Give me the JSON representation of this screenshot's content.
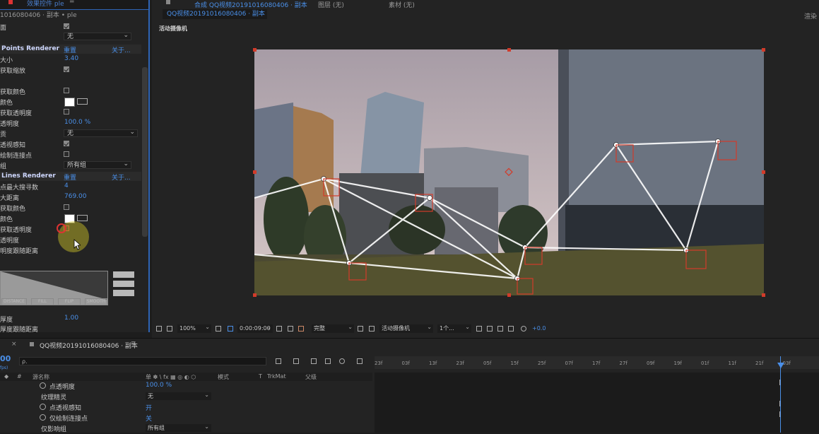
{
  "effects_panel": {
    "tab_title": "效果控件 ple",
    "subtitle": "1016080406 · 副本 • ple",
    "rows": [
      {
        "label": "面",
        "type": "checkbox",
        "checked": true
      },
      {
        "label": "",
        "type": "dropdown",
        "value": "无"
      },
      {
        "label": "Points Renderer",
        "type": "header",
        "reset": "重置",
        "about": "关于..."
      },
      {
        "label": "大小",
        "type": "value",
        "value": "3.40"
      },
      {
        "label": "获取缩放",
        "type": "checkbox",
        "checked": true
      },
      {
        "label": "获取颜色",
        "type": "checkbox",
        "checked": false
      },
      {
        "label": "颜色",
        "type": "color"
      },
      {
        "label": "获取透明度",
        "type": "checkbox",
        "checked": false
      },
      {
        "label": "透明度",
        "type": "value",
        "value": "100.0 %"
      },
      {
        "label": "贡",
        "type": "dropdown",
        "value": "无"
      },
      {
        "label": "透视感知",
        "type": "checkbox",
        "checked": true
      },
      {
        "label": "绘制连接点",
        "type": "checkbox",
        "checked": false
      },
      {
        "label": "组",
        "type": "dropdown",
        "value": "所有组"
      },
      {
        "label": "Lines Renderer",
        "type": "header",
        "reset": "重置",
        "about": "关于..."
      },
      {
        "label": "点最大搜寻数",
        "type": "value",
        "value": "4"
      },
      {
        "label": "大距离",
        "type": "value",
        "value": "769.00"
      },
      {
        "label": "获取颜色",
        "type": "checkbox",
        "checked": false
      },
      {
        "label": "颜色",
        "type": "color"
      },
      {
        "label": "获取透明度",
        "type": "checkbox",
        "checked": false
      },
      {
        "label": "透明度",
        "type": "value",
        "value": ""
      },
      {
        "label": "明度跟随距离",
        "type": "text"
      }
    ],
    "curve_buttons": [
      "DISTANCE",
      "FILL",
      "FLIP",
      "SMOOTH"
    ],
    "bottom_rows": [
      {
        "label": "厚度",
        "value": "1.00"
      },
      {
        "label": "厚度跟随距离",
        "value": ""
      }
    ]
  },
  "viewer": {
    "tabs": [
      "合成 QQ视频20191016080406 · 副本",
      "图层 (无)",
      "素材 (无)"
    ],
    "comp_tab": "QQ视频20191016080406 · 副本",
    "camera_label": "活动摄像机",
    "top_right_hint": "渲染",
    "toolbar": {
      "zoom": "100%",
      "timecode": "0:00:09:00",
      "resolution": "完整",
      "camera": "活动摄像机",
      "views": "1个...",
      "exposure": "+0.0"
    },
    "colors": {
      "handle": "#d23b2a",
      "accent": "#4a8fe8"
    }
  },
  "timeline": {
    "tab_title": "QQ视频20191016080406 · 副本",
    "current_time": "00",
    "fps_hint": "fps)",
    "search_placeholder": "ρ.",
    "column_headers": {
      "source_name": "源名称",
      "switches": "单 ✽ \\ fx ▦ ◎ ◐ ⬡",
      "mode": "模式",
      "t": "T",
      "trkmat": "TrkMat",
      "parent": "父级"
    },
    "rows": [
      {
        "name": "点透明度",
        "stopwatch": true,
        "value": "100.0 %",
        "type": "value"
      },
      {
        "name": "纹理精灵",
        "stopwatch": false,
        "value": "无",
        "type": "dropdown"
      },
      {
        "name": "点透视感知",
        "stopwatch": true,
        "value": "开",
        "type": "value"
      },
      {
        "name": "仅绘制连接点",
        "stopwatch": true,
        "value": "关",
        "type": "value"
      },
      {
        "name": "仅影响组",
        "stopwatch": false,
        "value": "所有组",
        "type": "dropdown"
      }
    ],
    "ruler_ticks": [
      "23f",
      "03f",
      "13f",
      "23f",
      "05f",
      "15f",
      "25f",
      "07f",
      "17f",
      "27f",
      "09f",
      "19f",
      "01f",
      "11f",
      "21f",
      "03f"
    ]
  }
}
